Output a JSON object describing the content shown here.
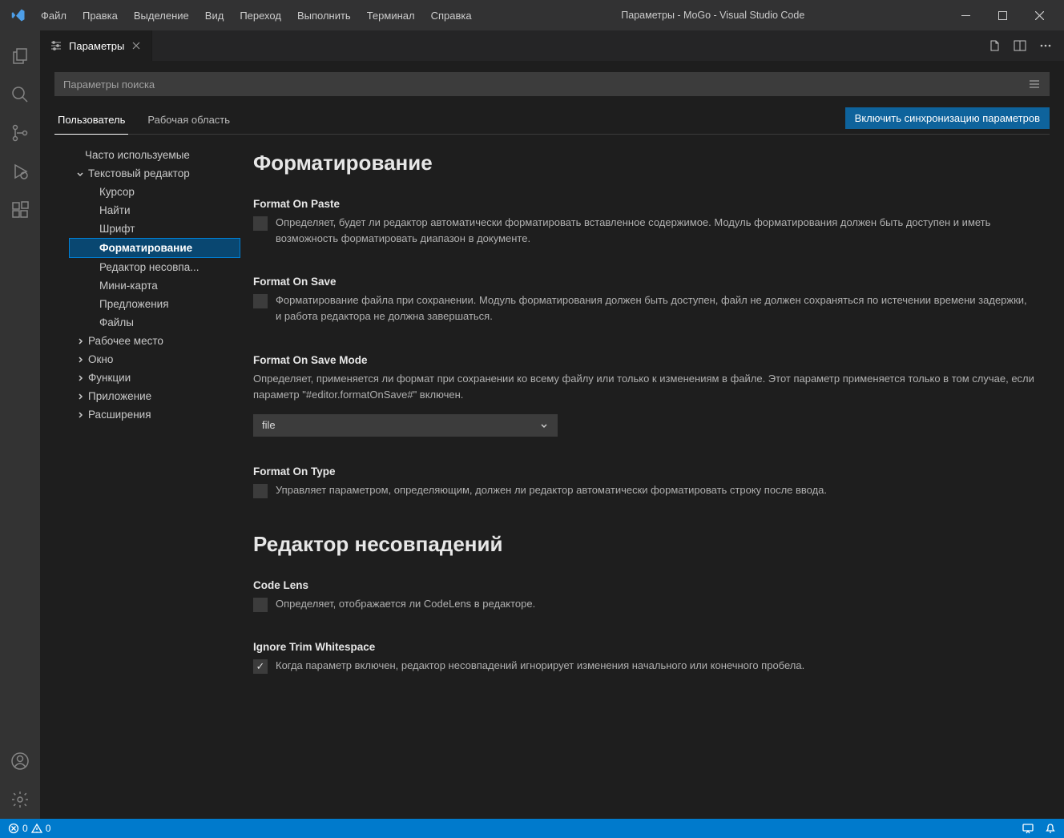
{
  "title": "Параметры - MoGo - Visual Studio Code",
  "menu": [
    "Файл",
    "Правка",
    "Выделение",
    "Вид",
    "Переход",
    "Выполнить",
    "Терминал",
    "Справка"
  ],
  "tab": {
    "label": "Параметры"
  },
  "search": {
    "placeholder": "Параметры поиска"
  },
  "scope": {
    "user": "Пользователь",
    "workspace": "Рабочая область"
  },
  "sync_button": "Включить синхронизацию параметров",
  "toc": {
    "frequently": "Часто используемые",
    "text_editor": "Текстовый редактор",
    "children": {
      "cursor": "Курсор",
      "find": "Найти",
      "font": "Шрифт",
      "formatting": "Форматирование",
      "diffeditor": "Редактор несовпа...",
      "minimap": "Мини-карта",
      "suggestions": "Предложения",
      "files": "Файлы"
    },
    "workbench": "Рабочее место",
    "window": "Окно",
    "features": "Функции",
    "application": "Приложение",
    "extensions": "Расширения"
  },
  "sections": {
    "formatting": "Форматирование",
    "diffeditor": "Редактор несовпадений"
  },
  "settings": {
    "formatOnPaste": {
      "title": "Format On Paste",
      "desc": "Определяет, будет ли редактор автоматически форматировать вставленное содержимое. Модуль форматирования должен быть доступен и иметь возможность форматировать диапазон в документе.",
      "checked": false
    },
    "formatOnSave": {
      "title": "Format On Save",
      "desc": "Форматирование файла при сохранении. Модуль форматирования должен быть доступен, файл не должен сохраняться по истечении времени задержки, и работа редактора не должна завершаться.",
      "checked": false
    },
    "formatOnSaveMode": {
      "title": "Format On Save Mode",
      "desc": "Определяет, применяется ли формат при сохранении ко всему файлу или только к изменениям в файле. Этот параметр применяется только в том случае, если параметр \"#editor.formatOnSave#\" включен.",
      "value": "file"
    },
    "formatOnType": {
      "title": "Format On Type",
      "desc": "Управляет параметром, определяющим, должен ли редактор автоматически форматировать строку после ввода.",
      "checked": false
    },
    "codeLens": {
      "title": "Code Lens",
      "desc": "Определяет, отображается ли CodeLens в редакторе.",
      "checked": false
    },
    "ignoreTrimWhitespace": {
      "title": "Ignore Trim Whitespace",
      "desc": "Когда параметр включен, редактор несовпадений игнорирует изменения начального или конечного пробела.",
      "checked": true
    }
  },
  "status": {
    "errors": "0",
    "warnings": "0"
  }
}
